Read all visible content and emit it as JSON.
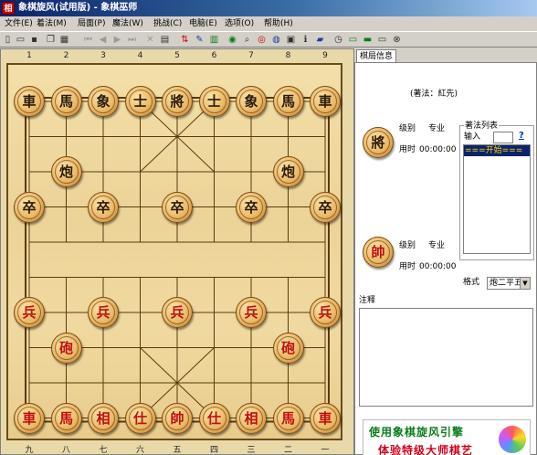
{
  "window": {
    "title": "象棋旋风(试用版) - 象棋巫师",
    "icon_text": "相"
  },
  "menu": [
    "文件(E)",
    "着法(M)",
    "局面(P)",
    "魔法(W)",
    "挑战(C)",
    "电脑(E)",
    "选项(O)",
    "帮助(H)"
  ],
  "toolbar": [
    {
      "icon": "new-icon",
      "glyph": "▯"
    },
    {
      "icon": "open-icon",
      "glyph": "▭"
    },
    {
      "icon": "save-icon",
      "glyph": "▪"
    },
    {
      "icon": "copy-icon",
      "glyph": "❐"
    },
    {
      "icon": "board-icon",
      "glyph": "▦"
    },
    {
      "icon": "first-move-icon",
      "glyph": "⏮"
    },
    {
      "icon": "prev-move-icon",
      "glyph": "◀"
    },
    {
      "icon": "next-move-icon",
      "glyph": "▶"
    },
    {
      "icon": "last-move-icon",
      "glyph": "⏭"
    },
    {
      "icon": "delete-icon",
      "glyph": "✕"
    },
    {
      "icon": "paste-icon",
      "glyph": "▤"
    },
    {
      "icon": "flip-icon",
      "glyph": "⇅"
    },
    {
      "icon": "edit-icon",
      "glyph": "✎"
    },
    {
      "icon": "stats-icon",
      "glyph": "▥"
    },
    {
      "icon": "color-icon",
      "glyph": "◉"
    },
    {
      "icon": "search-icon",
      "glyph": "⌕"
    },
    {
      "icon": "eye-icon",
      "glyph": "◎"
    },
    {
      "icon": "web-icon",
      "glyph": "◍"
    },
    {
      "icon": "print-icon",
      "glyph": "▣"
    },
    {
      "icon": "info-icon",
      "glyph": "ℹ"
    },
    {
      "icon": "book-icon",
      "glyph": "▰"
    },
    {
      "icon": "timer-icon",
      "glyph": "◷"
    },
    {
      "icon": "monitor-icon",
      "glyph": "▭"
    },
    {
      "icon": "terminal-icon",
      "glyph": "▬"
    },
    {
      "icon": "screen-icon",
      "glyph": "▭"
    },
    {
      "icon": "close-icon",
      "glyph": "⊗"
    }
  ],
  "board": {
    "top_numbers": [
      "1",
      "2",
      "3",
      "4",
      "5",
      "6",
      "7",
      "8",
      "9"
    ],
    "bottom_numbers": [
      "九",
      "八",
      "七",
      "六",
      "五",
      "四",
      "三",
      "二",
      "一"
    ],
    "pieces": [
      {
        "text": "車",
        "side": "black",
        "file": 0,
        "rank": 0
      },
      {
        "text": "馬",
        "side": "black",
        "file": 1,
        "rank": 0
      },
      {
        "text": "象",
        "side": "black",
        "file": 2,
        "rank": 0
      },
      {
        "text": "士",
        "side": "black",
        "file": 3,
        "rank": 0
      },
      {
        "text": "將",
        "side": "black",
        "file": 4,
        "rank": 0
      },
      {
        "text": "士",
        "side": "black",
        "file": 5,
        "rank": 0
      },
      {
        "text": "象",
        "side": "black",
        "file": 6,
        "rank": 0
      },
      {
        "text": "馬",
        "side": "black",
        "file": 7,
        "rank": 0
      },
      {
        "text": "車",
        "side": "black",
        "file": 8,
        "rank": 0
      },
      {
        "text": "炮",
        "side": "black",
        "file": 1,
        "rank": 2
      },
      {
        "text": "炮",
        "side": "black",
        "file": 7,
        "rank": 2
      },
      {
        "text": "卒",
        "side": "black",
        "file": 0,
        "rank": 3
      },
      {
        "text": "卒",
        "side": "black",
        "file": 2,
        "rank": 3
      },
      {
        "text": "卒",
        "side": "black",
        "file": 4,
        "rank": 3
      },
      {
        "text": "卒",
        "side": "black",
        "file": 6,
        "rank": 3
      },
      {
        "text": "卒",
        "side": "black",
        "file": 8,
        "rank": 3
      },
      {
        "text": "兵",
        "side": "red",
        "file": 0,
        "rank": 6
      },
      {
        "text": "兵",
        "side": "red",
        "file": 2,
        "rank": 6
      },
      {
        "text": "兵",
        "side": "red",
        "file": 4,
        "rank": 6
      },
      {
        "text": "兵",
        "side": "red",
        "file": 6,
        "rank": 6
      },
      {
        "text": "兵",
        "side": "red",
        "file": 8,
        "rank": 6
      },
      {
        "text": "砲",
        "side": "red",
        "file": 1,
        "rank": 7
      },
      {
        "text": "砲",
        "side": "red",
        "file": 7,
        "rank": 7
      },
      {
        "text": "車",
        "side": "red",
        "file": 0,
        "rank": 9
      },
      {
        "text": "馬",
        "side": "red",
        "file": 1,
        "rank": 9
      },
      {
        "text": "相",
        "side": "red",
        "file": 2,
        "rank": 9
      },
      {
        "text": "仕",
        "side": "red",
        "file": 3,
        "rank": 9
      },
      {
        "text": "帥",
        "side": "red",
        "file": 4,
        "rank": 9
      },
      {
        "text": "仕",
        "side": "red",
        "file": 5,
        "rank": 9
      },
      {
        "text": "相",
        "side": "red",
        "file": 6,
        "rank": 9
      },
      {
        "text": "馬",
        "side": "red",
        "file": 7,
        "rank": 9
      },
      {
        "text": "車",
        "side": "red",
        "file": 8,
        "rank": 9
      }
    ]
  },
  "panel": {
    "tab": "棋局信息",
    "move_side": "(著法：紅先)",
    "black_player": {
      "piece": "將",
      "level_label": "级别",
      "level": "专业",
      "time_label": "用时",
      "time": "00:00:00"
    },
    "red_player": {
      "piece": "帥",
      "level_label": "级别",
      "level": "专业",
      "time_label": "用时",
      "time": "00:00:00"
    },
    "movelist_title": "著法列表",
    "input_label": "输入",
    "input_value": "",
    "help": "?",
    "moves": [
      "===开始==="
    ],
    "format_label": "格式",
    "format_value": "炮二平五",
    "notes_label": "注释",
    "notes": "",
    "banner_line1": "使用象棋旋风引擎",
    "banner_line2": "体验特级大师棋艺"
  }
}
